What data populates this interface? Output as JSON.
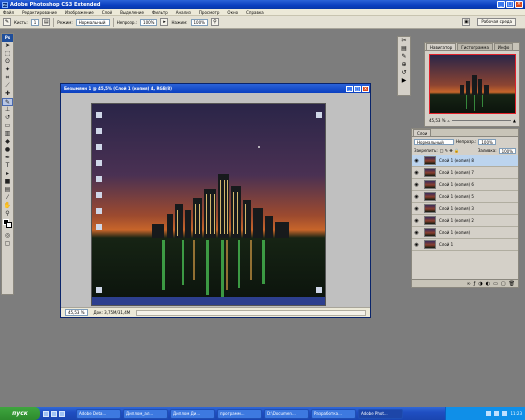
{
  "window": {
    "title": "Adobe Photoshop CS3 Extended",
    "min": "_",
    "max": "□",
    "close": "×"
  },
  "menu": [
    "Файл",
    "Редактирование",
    "Изображение",
    "Слой",
    "Выделение",
    "Фильтр",
    "Анализ",
    "Просмотр",
    "Окно",
    "Справка"
  ],
  "options": {
    "brush_label": "Кисть:",
    "brush_size": "1",
    "mode_label": "Режим:",
    "mode_value": "Нормальный",
    "opacity_label": "Непрозр.:",
    "opacity_value": "100%",
    "pressure_label": "Нажим:",
    "pressure_value": "100%",
    "workspace": "Рабочая среда"
  },
  "toolbox": {
    "logo": "Ps",
    "tools": [
      "move-tool",
      "marquee-tool",
      "lasso-tool",
      "magic-wand-tool",
      "crop-tool",
      "slice-tool",
      "healing-tool",
      "brush-tool",
      "stamp-tool",
      "history-brush-tool",
      "eraser-tool",
      "gradient-tool",
      "blur-tool",
      "dodge-tool",
      "pen-tool",
      "type-tool",
      "path-select-tool",
      "shape-tool",
      "notes-tool",
      "eyedropper-tool",
      "hand-tool",
      "zoom-tool"
    ]
  },
  "document": {
    "title": "Безымянн 1 @ 45,5% (Слой 1 (копия) 4, RGB/8)",
    "zoom": "45,53 %",
    "info": "Док: 3,75M/31,4M"
  },
  "navigator": {
    "tabs": [
      "Навигатор",
      "Гистограмма",
      "Инфо"
    ],
    "zoom": "45,53 %"
  },
  "layers": {
    "tab": "Слои",
    "blend_mode": "Нормальный",
    "opacity_label": "Непрозр.:",
    "opacity_value": "100%",
    "lock_label": "Закрепить:",
    "fill_label": "Заливка:",
    "fill_value": "100%",
    "items": [
      "Слой 1 (копия) 8",
      "Слой 1 (копия) 7",
      "Слой 1 (копия) 6",
      "Слой 1 (копия) 5",
      "Слой 1 (копия) 3",
      "Слой 1 (копия) 2",
      "Слой 1 (копия)",
      "Слой 1"
    ],
    "selected_index": 0
  },
  "taskbar": {
    "start": "пуск",
    "tasks": [
      "Adobe Deta...",
      "Диплом_ал...",
      "Диплом Ди...",
      "программ...",
      "D:\\Documen...",
      "Разработка...",
      "Adobe Phot..."
    ],
    "active_index": 6,
    "clock": "11:23"
  }
}
